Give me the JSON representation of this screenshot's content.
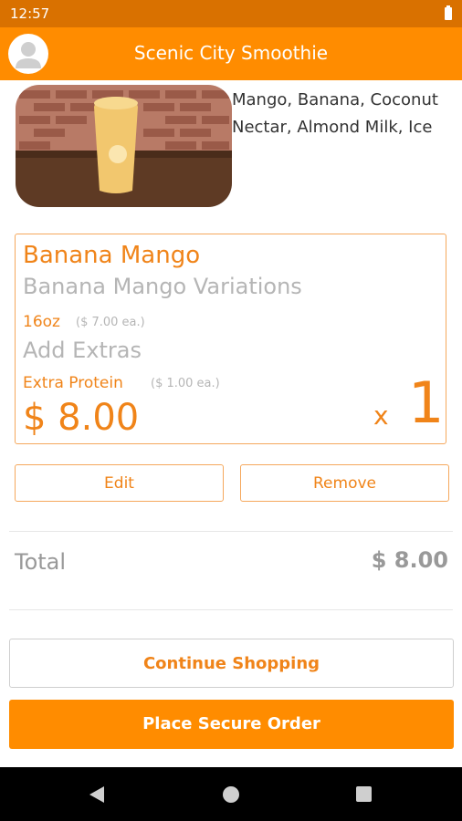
{
  "status": {
    "time": "12:57"
  },
  "header": {
    "title": "Scenic City Smoothie"
  },
  "product": {
    "ingredients": "Mango, Banana, Coconut Nectar, Almond Milk, Ice"
  },
  "cart_item": {
    "name": "Banana Mango",
    "variation": "Banana Mango Variations",
    "size": "16oz",
    "size_price": "($ 7.00 ea.)",
    "extras_heading": "Add Extras",
    "extra": "Extra Protein",
    "extra_price": "($ 1.00 ea.)",
    "total": "$ 8.00",
    "qty_prefix": "x",
    "quantity": "1",
    "edit_label": "Edit",
    "remove_label": "Remove"
  },
  "summary": {
    "total_label": "Total",
    "total_value": "$ 8.00"
  },
  "actions": {
    "continue_label": "Continue Shopping",
    "order_label": "Place Secure Order"
  },
  "colors": {
    "brand": "#ff8c00",
    "status_bar": "#d97100",
    "accent_text": "#f08419",
    "muted_text": "#b5b5b5"
  },
  "icons": {
    "avatar": "user-avatar-icon",
    "battery": "battery-icon",
    "nav_back": "back-triangle-icon",
    "nav_home": "home-circle-icon",
    "nav_recent": "recent-square-icon"
  }
}
